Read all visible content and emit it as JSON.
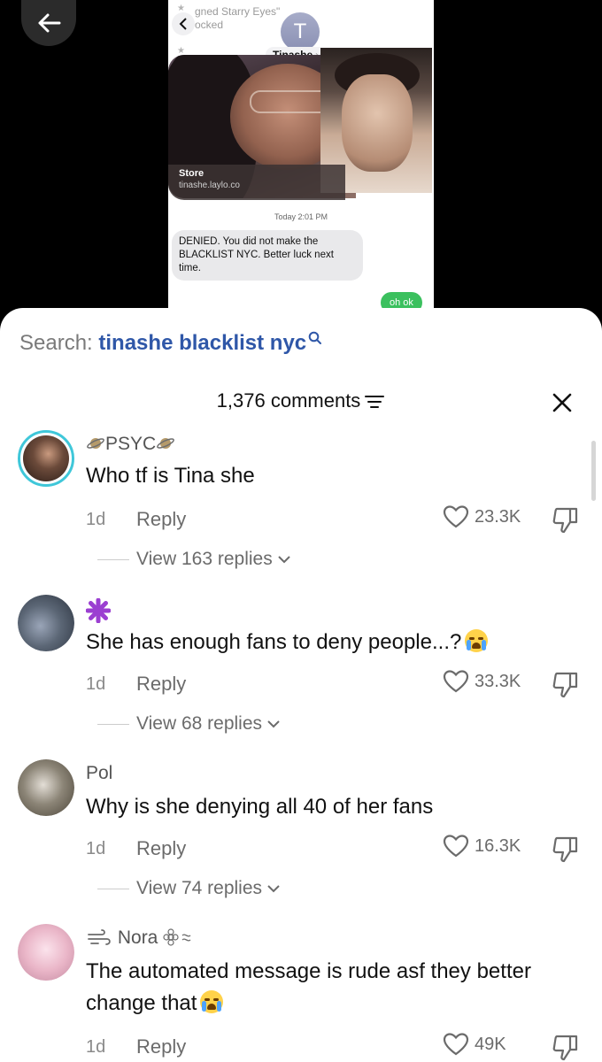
{
  "video": {
    "notification_text_line1": "gned Starry Eyes\"",
    "notification_text_line2": "ocked",
    "contact_initial": "T",
    "contact_name": "Tinashe",
    "store_title": "Store",
    "store_link": "tinashe.laylo.co",
    "message_time": "Today 2:01 PM",
    "incoming_message": "DENIED. You did not make the BLACKLIST NYC. Better luck next time.",
    "outgoing_message": "oh ok"
  },
  "search": {
    "prefix": "Search: ",
    "query": "tinashe blacklist nyc"
  },
  "comments_header": {
    "count_label": "1,376 comments"
  },
  "comments": [
    {
      "username": "PSYC",
      "text": "Who tf is Tina she",
      "time": "1d",
      "reply_label": "Reply",
      "likes": "23.3K",
      "view_replies": "View 163 replies"
    },
    {
      "username": "",
      "text": "She has enough fans to deny people...?",
      "time": "1d",
      "reply_label": "Reply",
      "likes": "33.3K",
      "view_replies": "View 68 replies"
    },
    {
      "username": "Pol",
      "text": "Why is she denying all 40 of her fans",
      "time": "1d",
      "reply_label": "Reply",
      "likes": "16.3K",
      "view_replies": "View 74 replies"
    },
    {
      "username": "Nora",
      "text": "The automated message is rude asf they better change that",
      "time": "1d",
      "reply_label": "Reply",
      "likes": "49K"
    }
  ],
  "colors": {
    "accent_link": "#2f57a8",
    "story_ring": "#3fc7d9",
    "outgoing_bubble": "#3bc05e"
  }
}
